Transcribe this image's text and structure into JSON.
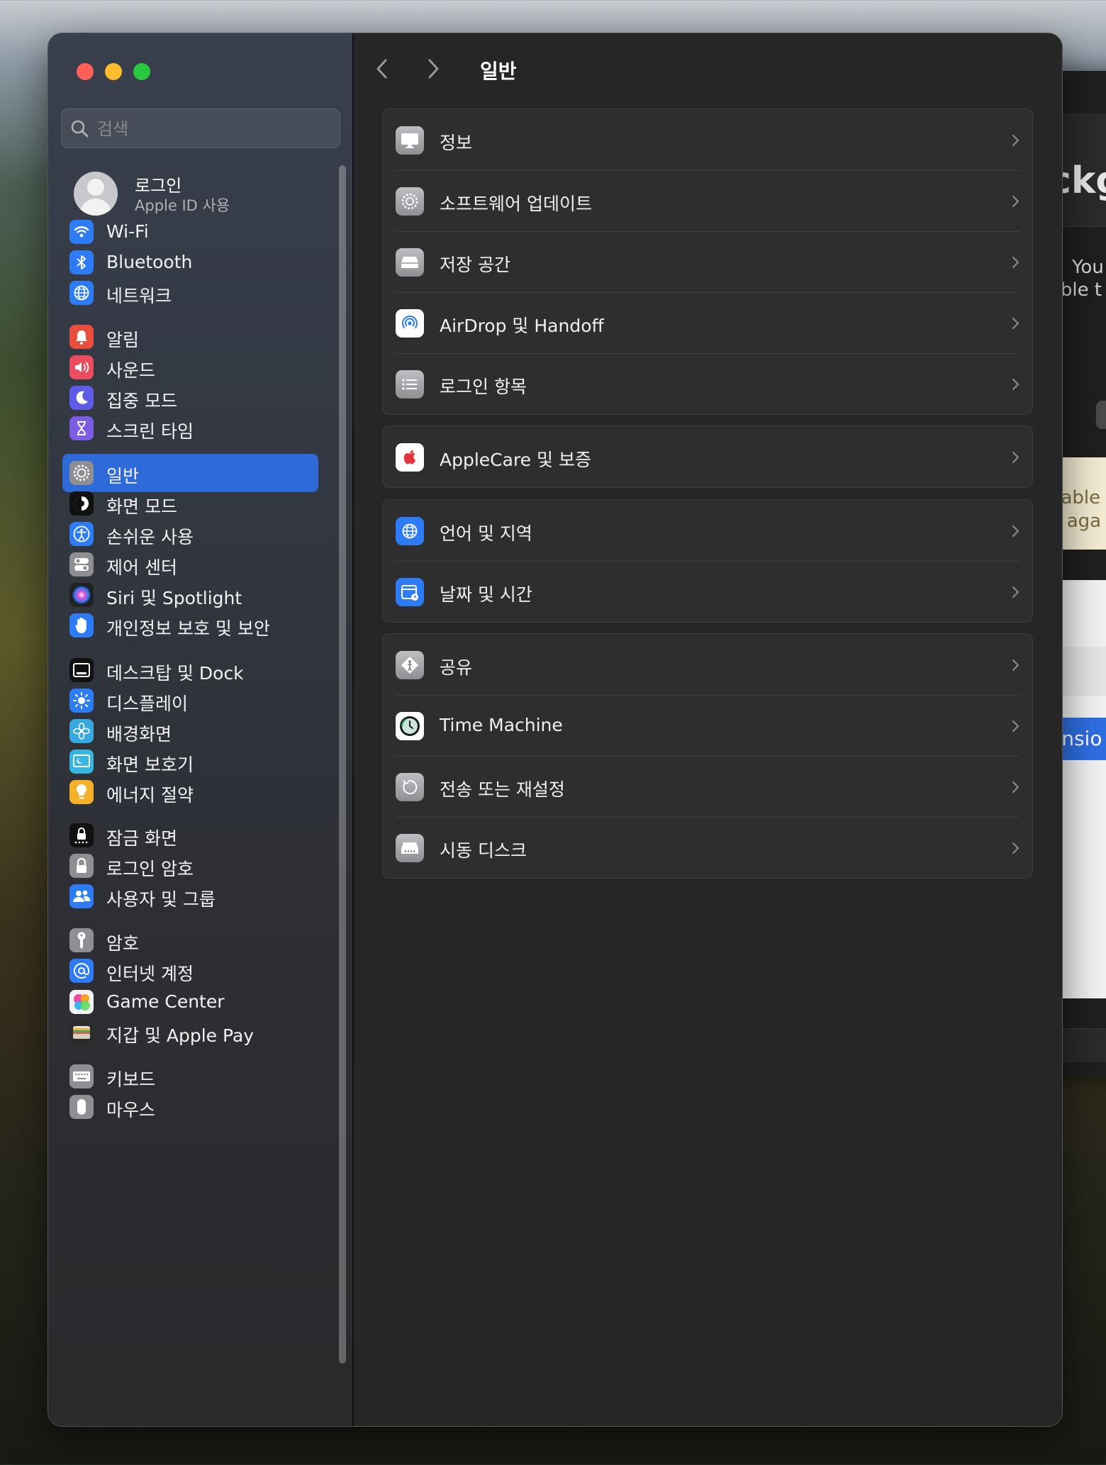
{
  "window": {
    "title": "일반"
  },
  "search": {
    "placeholder": "검색"
  },
  "account": {
    "name": "로그인",
    "subtitle": "Apple ID 사용"
  },
  "sidebar": {
    "items": [
      {
        "label": "Wi-Fi",
        "icon": "wifi-icon",
        "color": "#2d7cf6"
      },
      {
        "label": "Bluetooth",
        "icon": "bluetooth-icon",
        "color": "#2d7cf6"
      },
      {
        "label": "네트워크",
        "icon": "globe-icon",
        "color": "#2d7cf6"
      },
      {
        "label": "알림",
        "icon": "bell-icon",
        "color": "#eb4d3d"
      },
      {
        "label": "사운드",
        "icon": "speaker-icon",
        "color": "#eb4d5f"
      },
      {
        "label": "집중 모드",
        "icon": "moon-icon",
        "color": "#5e5ce6"
      },
      {
        "label": "스크린 타임",
        "icon": "hourglass-icon",
        "color": "#7d5ce6"
      },
      {
        "label": "일반",
        "icon": "gear-icon",
        "color": "#8e8e93",
        "selected": true
      },
      {
        "label": "화면 모드",
        "icon": "appearance-icon",
        "color": "#111111"
      },
      {
        "label": "손쉬운 사용",
        "icon": "accessibility-icon",
        "color": "#2d7cf6"
      },
      {
        "label": "제어 센터",
        "icon": "toggles-icon",
        "color": "#8e8e93"
      },
      {
        "label": "Siri 및 Spotlight",
        "icon": "siri-icon",
        "color": "#222222"
      },
      {
        "label": "개인정보 보호 및 보안",
        "icon": "hand-icon",
        "color": "#2d7cf6"
      },
      {
        "label": "데스크탑 및 Dock",
        "icon": "dock-icon",
        "color": "#111111"
      },
      {
        "label": "디스플레이",
        "icon": "sun-icon",
        "color": "#2d7cf6"
      },
      {
        "label": "배경화면",
        "icon": "flower-icon",
        "color": "#36a9e0"
      },
      {
        "label": "화면 보호기",
        "icon": "screensaver-icon",
        "color": "#36b5e0"
      },
      {
        "label": "에너지 절약",
        "icon": "lightbulb-icon",
        "color": "#f5b12a"
      },
      {
        "label": "잠금 화면",
        "icon": "lock-screen-icon",
        "color": "#111111"
      },
      {
        "label": "로그인 암호",
        "icon": "lock-icon",
        "color": "#8e8e93"
      },
      {
        "label": "사용자 및 그룹",
        "icon": "users-icon",
        "color": "#2d7cf6"
      },
      {
        "label": "암호",
        "icon": "key-icon",
        "color": "#8e8e93"
      },
      {
        "label": "인터넷 계정",
        "icon": "at-icon",
        "color": "#2d7cf6"
      },
      {
        "label": "Game Center",
        "icon": "game-center-icon",
        "color": "#f2f2f2"
      },
      {
        "label": "지갑 및 Apple Pay",
        "icon": "wallet-icon",
        "color": "#2b2b2b"
      },
      {
        "label": "키보드",
        "icon": "keyboard-icon",
        "color": "#8e8e93"
      },
      {
        "label": "마우스",
        "icon": "mouse-icon",
        "color": "#8e8e93"
      }
    ]
  },
  "main": {
    "groups": [
      {
        "rows": [
          {
            "label": "정보",
            "icon": "display-icon"
          },
          {
            "label": "소프트웨어 업데이트",
            "icon": "gear-badge-icon"
          },
          {
            "label": "저장 공간",
            "icon": "drive-icon"
          },
          {
            "label": "AirDrop 및 Handoff",
            "icon": "airdrop-icon"
          },
          {
            "label": "로그인 항목",
            "icon": "list-icon"
          }
        ]
      },
      {
        "rows": [
          {
            "label": "AppleCare 및 보증",
            "icon": "apple-icon"
          }
        ]
      },
      {
        "rows": [
          {
            "label": "언어 및 지역",
            "icon": "globe-icon"
          },
          {
            "label": "날짜 및 시간",
            "icon": "calendar-clock-icon"
          }
        ]
      },
      {
        "rows": [
          {
            "label": "공유",
            "icon": "sharing-icon"
          },
          {
            "label": "Time Machine",
            "icon": "time-machine-icon"
          },
          {
            "label": "전송 또는 재설정",
            "icon": "reset-icon"
          },
          {
            "label": "시동 디스크",
            "icon": "startup-disk-icon"
          }
        ]
      }
    ]
  },
  "background_window": {
    "header_text": "ckg",
    "line1": "You",
    "line2": "able t",
    "warn1": "nable",
    "warn2": "n aga",
    "selected_row": "ensio"
  }
}
